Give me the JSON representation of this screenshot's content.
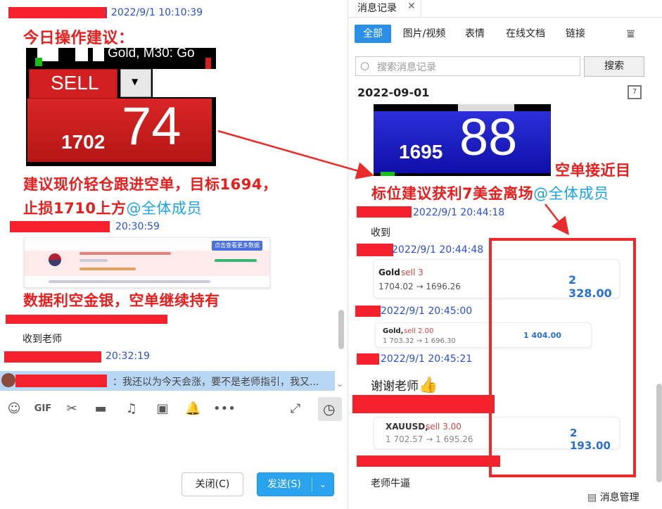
{
  "left": {
    "msg1_time": ") 2022/9/1 10:10:39",
    "heading": "今日操作建议：",
    "mt_title": "Gold, M30:  Go",
    "sell_label": "SELL",
    "sell_price_small": "1702",
    "sell_price_big": "74",
    "advice_line1": "建议现价轻仓跟进空单，目标1694，",
    "advice_line2": "止损1710上方",
    "mention": "@全体成员",
    "msg2_time": "20:30:59",
    "data_note": "数据利空金银，空单继续持有",
    "news_header_label": "点击查看更多数据",
    "ack1": "收到老师",
    "msg4_time": "20:32:19",
    "quote_text": "：我还以为今天会涨，要不是老师指引，我又...",
    "btn_close": "关闭(C)",
    "btn_send": "发送(S)"
  },
  "right": {
    "tab_title": "消息记录",
    "tab_close": "✕",
    "filters": [
      "全部",
      "图片/视频",
      "表情",
      "在线文档",
      "链接"
    ],
    "search_placeholder": "搜索消息记录",
    "search_button": "搜索",
    "date": "2022-09-01",
    "buy_price_small": "1695",
    "buy_price_big": "88",
    "annotation_line1": "空单接近目",
    "annotation_line2": "标位建议获利7美金离场",
    "mention": "@全体成员",
    "entries": [
      {
        "time": "2022/9/1 20:44:18",
        "text": "收到"
      },
      {
        "time": "2022/9/1 20:44:48"
      },
      {
        "time": "2022/9/1 20:45:00"
      },
      {
        "time": "2022/9/1 20:45:21",
        "text": "谢谢老师"
      },
      {
        "text": "老师牛逼"
      }
    ],
    "trade1": {
      "symbol": "Gold",
      "side": "sell 3",
      "route": "1704.02 → 1696.26",
      "profit": "2 328.00"
    },
    "trade2": {
      "symbol": "Gold,",
      "side": "sell 2.00",
      "route": "1 703.32 → 1 696.30",
      "profit": "1 404.00"
    },
    "trade3": {
      "symbol": "XAUUSD,",
      "side": "sell 3.00",
      "route": "1 702.57 → 1 695.26",
      "profit": "2 193.00"
    },
    "manage": "消息管理"
  },
  "colors": {
    "accent_blue": "#2a8fe6",
    "annotation_red": "#ea1d1d",
    "time_blue": "#2a4fd6",
    "profit_blue": "#2a6fd6"
  }
}
